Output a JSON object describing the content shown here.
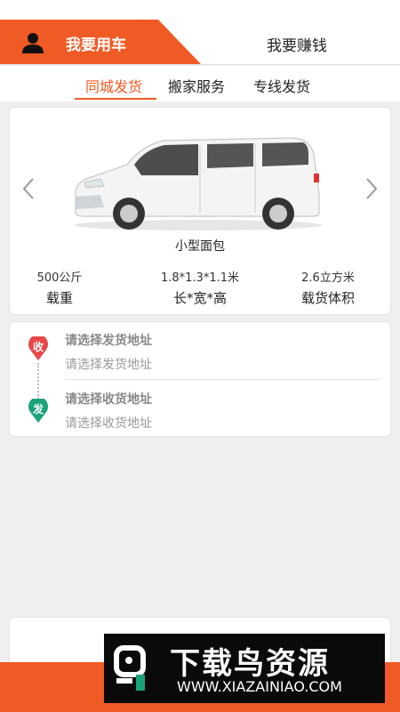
{
  "header": {
    "active_tab": "我要用车",
    "other_tab": "我要赚钱",
    "accent": "#f05a24"
  },
  "subtabs": [
    {
      "label": "同城发货",
      "active": true
    },
    {
      "label": "搬家服务",
      "active": false
    },
    {
      "label": "专线发货",
      "active": false
    }
  ],
  "vehicle": {
    "name": "小型面包",
    "specs": [
      {
        "value": "500公斤",
        "label": "载重"
      },
      {
        "value": "1.8*1.3*1.1米",
        "label": "长*宽*高"
      },
      {
        "value": "2.6立方米",
        "label": "载货体积"
      }
    ]
  },
  "address": {
    "from": {
      "badge": "收",
      "title": "请选择发货地址",
      "placeholder": "请选择发货地址",
      "color": "#e8474a"
    },
    "to": {
      "badge": "发",
      "title": "请选择收货地址",
      "placeholder": "请选择收货地址",
      "color": "#1aa37a"
    }
  },
  "watermark": {
    "title": "下载鸟资源",
    "url": "WWW.XIAZAINIAO.COM"
  }
}
